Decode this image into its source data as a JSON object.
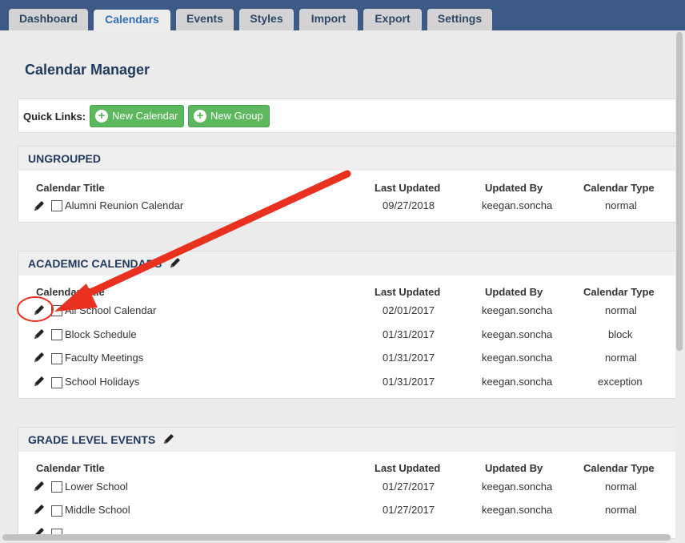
{
  "tabs": [
    {
      "label": "Dashboard",
      "active": false
    },
    {
      "label": "Calendars",
      "active": true
    },
    {
      "label": "Events",
      "active": false
    },
    {
      "label": "Styles",
      "active": false
    },
    {
      "label": "Import",
      "active": false
    },
    {
      "label": "Export",
      "active": false
    },
    {
      "label": "Settings",
      "active": false
    }
  ],
  "page_title": "Calendar Manager",
  "quick_links": {
    "label": "Quick Links:",
    "new_calendar": "New Calendar",
    "new_group": "New Group",
    "plus_icon": "+"
  },
  "columns": {
    "title": "Calendar Title",
    "updated": "Last Updated",
    "by": "Updated By",
    "type": "Calendar Type"
  },
  "groups": [
    {
      "name": "UNGROUPED",
      "editable": false,
      "rows": [
        {
          "title": "Alumni Reunion Calendar",
          "updated": "09/27/2018",
          "by": "keegan.soncha",
          "type": "normal"
        }
      ]
    },
    {
      "name": "ACADEMIC CALENDARS",
      "editable": true,
      "rows": [
        {
          "title": "All School Calendar",
          "updated": "02/01/2017",
          "by": "keegan.soncha",
          "type": "normal"
        },
        {
          "title": "Block Schedule",
          "updated": "01/31/2017",
          "by": "keegan.soncha",
          "type": "block"
        },
        {
          "title": "Faculty Meetings",
          "updated": "01/31/2017",
          "by": "keegan.soncha",
          "type": "normal"
        },
        {
          "title": "School Holidays",
          "updated": "01/31/2017",
          "by": "keegan.soncha",
          "type": "exception"
        }
      ]
    },
    {
      "name": "GRADE LEVEL EVENTS",
      "editable": true,
      "rows": [
        {
          "title": "Lower School",
          "updated": "01/27/2017",
          "by": "keegan.soncha",
          "type": "normal"
        },
        {
          "title": "Middle School",
          "updated": "01/27/2017",
          "by": "keegan.soncha",
          "type": "normal"
        }
      ]
    }
  ],
  "colors": {
    "topbar": "#3d5a86",
    "accent_green": "#5cb85c",
    "annotation_red": "#e8321f"
  }
}
